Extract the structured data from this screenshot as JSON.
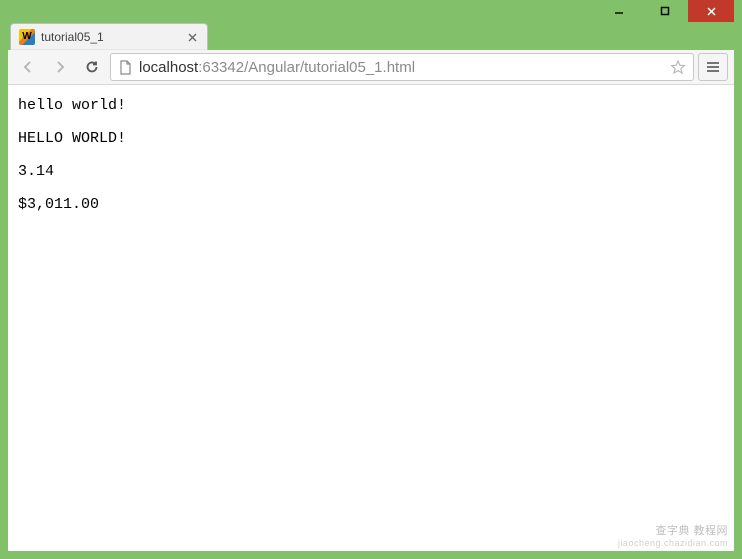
{
  "window": {
    "minimize_tooltip": "Minimize",
    "maximize_tooltip": "Maximize",
    "close_tooltip": "Close"
  },
  "tabs": [
    {
      "title": "tutorial05_1",
      "favicon_text": "W"
    }
  ],
  "toolbar": {
    "url_scheme": "",
    "url_host_main": "localhost",
    "url_host_port": ":63342",
    "url_path": "/Angular/tutorial05_1.html"
  },
  "page": {
    "lines": [
      "hello world!",
      "HELLO WORLD!",
      "3.14",
      "$3,011.00"
    ]
  },
  "watermark": {
    "line1": "查字典  教程网",
    "line2": "jiaocheng.chazidian.com"
  }
}
